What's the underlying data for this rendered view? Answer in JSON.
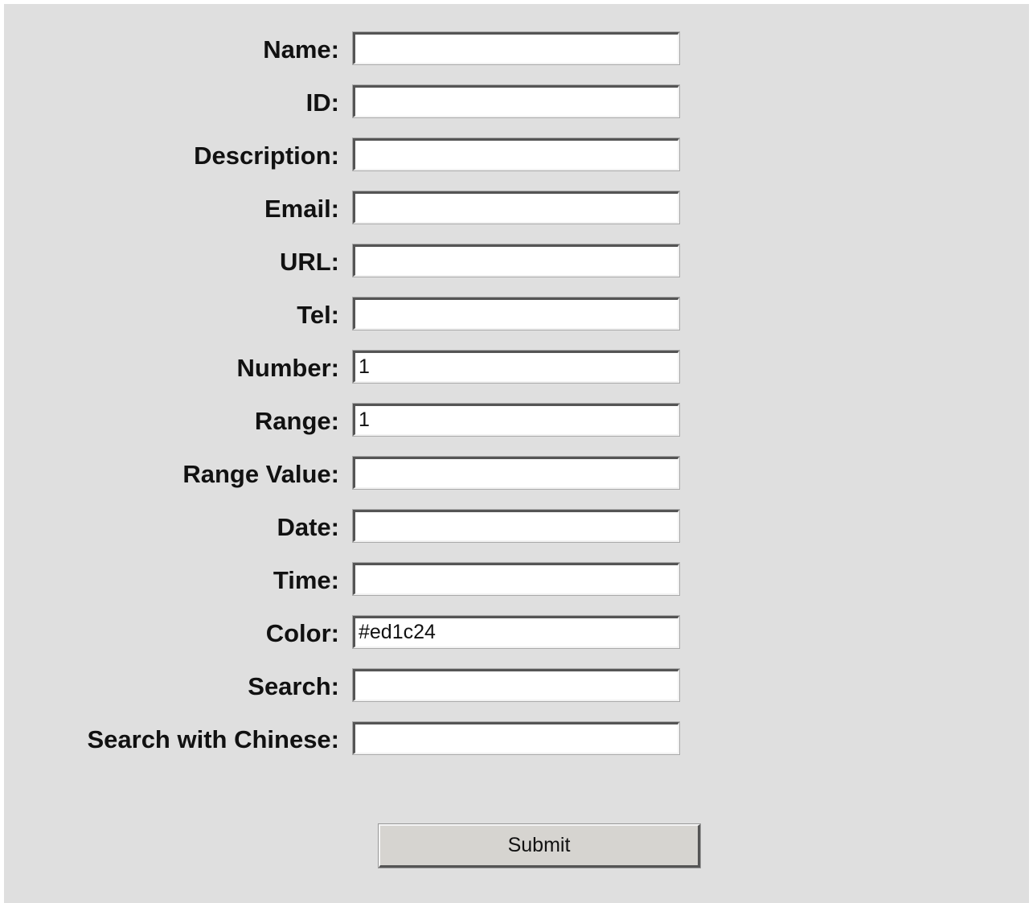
{
  "form": {
    "fields": [
      {
        "key": "name",
        "label": "Name:",
        "value": "",
        "placeholder": ""
      },
      {
        "key": "id",
        "label": "ID:",
        "value": "",
        "placeholder": ""
      },
      {
        "key": "description",
        "label": "Description:",
        "value": "",
        "placeholder": ""
      },
      {
        "key": "email",
        "label": "Email:",
        "value": "",
        "placeholder": ""
      },
      {
        "key": "url",
        "label": "URL:",
        "value": "",
        "placeholder": ""
      },
      {
        "key": "tel",
        "label": "Tel:",
        "value": "",
        "placeholder": ""
      },
      {
        "key": "number",
        "label": "Number:",
        "value": "1",
        "placeholder": ""
      },
      {
        "key": "range",
        "label": "Range:",
        "value": "1",
        "placeholder": ""
      },
      {
        "key": "range-value",
        "label": "Range Value:",
        "value": "",
        "placeholder": ""
      },
      {
        "key": "date",
        "label": "Date:",
        "value": "",
        "placeholder": ""
      },
      {
        "key": "time",
        "label": "Time:",
        "value": "",
        "placeholder": ""
      },
      {
        "key": "color",
        "label": "Color:",
        "value": "#ed1c24",
        "placeholder": ""
      },
      {
        "key": "search",
        "label": "Search:",
        "value": "",
        "placeholder": ""
      },
      {
        "key": "search-with-chinese",
        "label": "Search with Chinese:",
        "value": "",
        "placeholder": ""
      }
    ],
    "submit_label": "Submit"
  },
  "colors": {
    "background": "#dfdfdf",
    "field_background": "#ffffff",
    "button_background": "#d6d4d0"
  }
}
